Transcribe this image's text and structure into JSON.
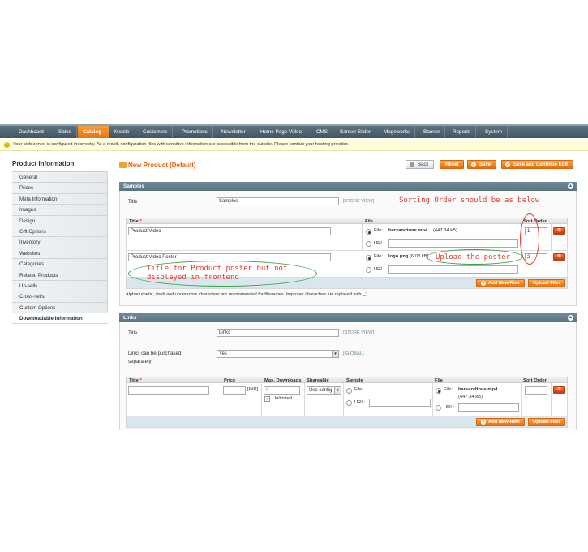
{
  "nav": {
    "items": [
      "Dashboard",
      "Sales",
      "Catalog",
      "Mobile",
      "Customers",
      "Promotions",
      "Newsletter",
      "Home Page Video",
      "CMS",
      "Banner Slider",
      "Mageworks",
      "Banner",
      "Reports",
      "System"
    ],
    "active": "Catalog"
  },
  "notice": {
    "text": "Your web server is configured incorrectly. As a result, configuration files with sensitive information are accessible from the outside. Please contact your hosting provider."
  },
  "sidebar": {
    "title": "Product Information",
    "items": [
      "General",
      "Prices",
      "Meta Information",
      "Images",
      "Design",
      "Gift Options",
      "Inventory",
      "Websites",
      "Categories",
      "Related Products",
      "Up-sells",
      "Cross-sells",
      "Custom Options",
      "Downloadable Information"
    ],
    "active_index": 13
  },
  "header": {
    "title": "New Product (Default)",
    "back": "Back",
    "reset": "Reset",
    "save": "Save",
    "save_continue": "Save and Continue Edit"
  },
  "samples": {
    "section_title": "Samples",
    "title_label": "Title",
    "title_value": "Samples",
    "scope": "[STORE VIEW]",
    "col_title": "Title",
    "col_file": "File",
    "col_sort": "Sort Order",
    "rows": [
      {
        "title": "Product Video",
        "file_label": "File:",
        "file_name": "barsandtone.mp4",
        "file_size": "(447.34 kB)",
        "url_label": "URL:",
        "sort": "1"
      },
      {
        "title": "Product Video Poster",
        "file_label": "File:",
        "file_name": "logo.png",
        "file_size": "(6.08 kB)",
        "url_label": "URL:",
        "sort": "2"
      }
    ],
    "add_row": "Add New Row",
    "upload": "Upload Files",
    "note": "Alphanumeric, dash and underscore characters are recommended for filenames. Improper characters are replaced with '_'."
  },
  "links": {
    "section_title": "Links",
    "title_label": "Title",
    "title_value": "Links",
    "scope": "[STORE VIEW]",
    "purchase_label_1": "Links can be purchased",
    "purchase_label_2": "separately",
    "purchase_value": "Yes",
    "purchase_scope": "[GLOBAL]",
    "cols": {
      "title": "Title",
      "price": "Price",
      "max": "Max. Downloads",
      "shareable": "Shareable",
      "sample": "Sample",
      "file": "File",
      "sort": "Sort Order"
    },
    "row": {
      "title": "-",
      "price": "",
      "currency": "[INR]",
      "max": "0",
      "unlimited": "Unlimited",
      "shareable": "Use config",
      "sample_file": "File:",
      "sample_url": "URL:",
      "file_label": "File:",
      "file_name": "barsandtone.mp4",
      "file_size": "(447.34 kB)",
      "url_label": "URL:"
    },
    "add_row": "Add New Row",
    "upload": "Upload Files"
  },
  "annotations": {
    "sorting": "Sorting Order should be as below",
    "upload_poster": "Upload the poster",
    "poster_title_1": "Title for Product poster but not",
    "poster_title_2": "displayed in frontend"
  },
  "colors": {
    "accent": "#eb5e00",
    "nav": "#4d606b",
    "annotation_red": "#e03a2a",
    "annotation_green": "#3aa34a"
  }
}
